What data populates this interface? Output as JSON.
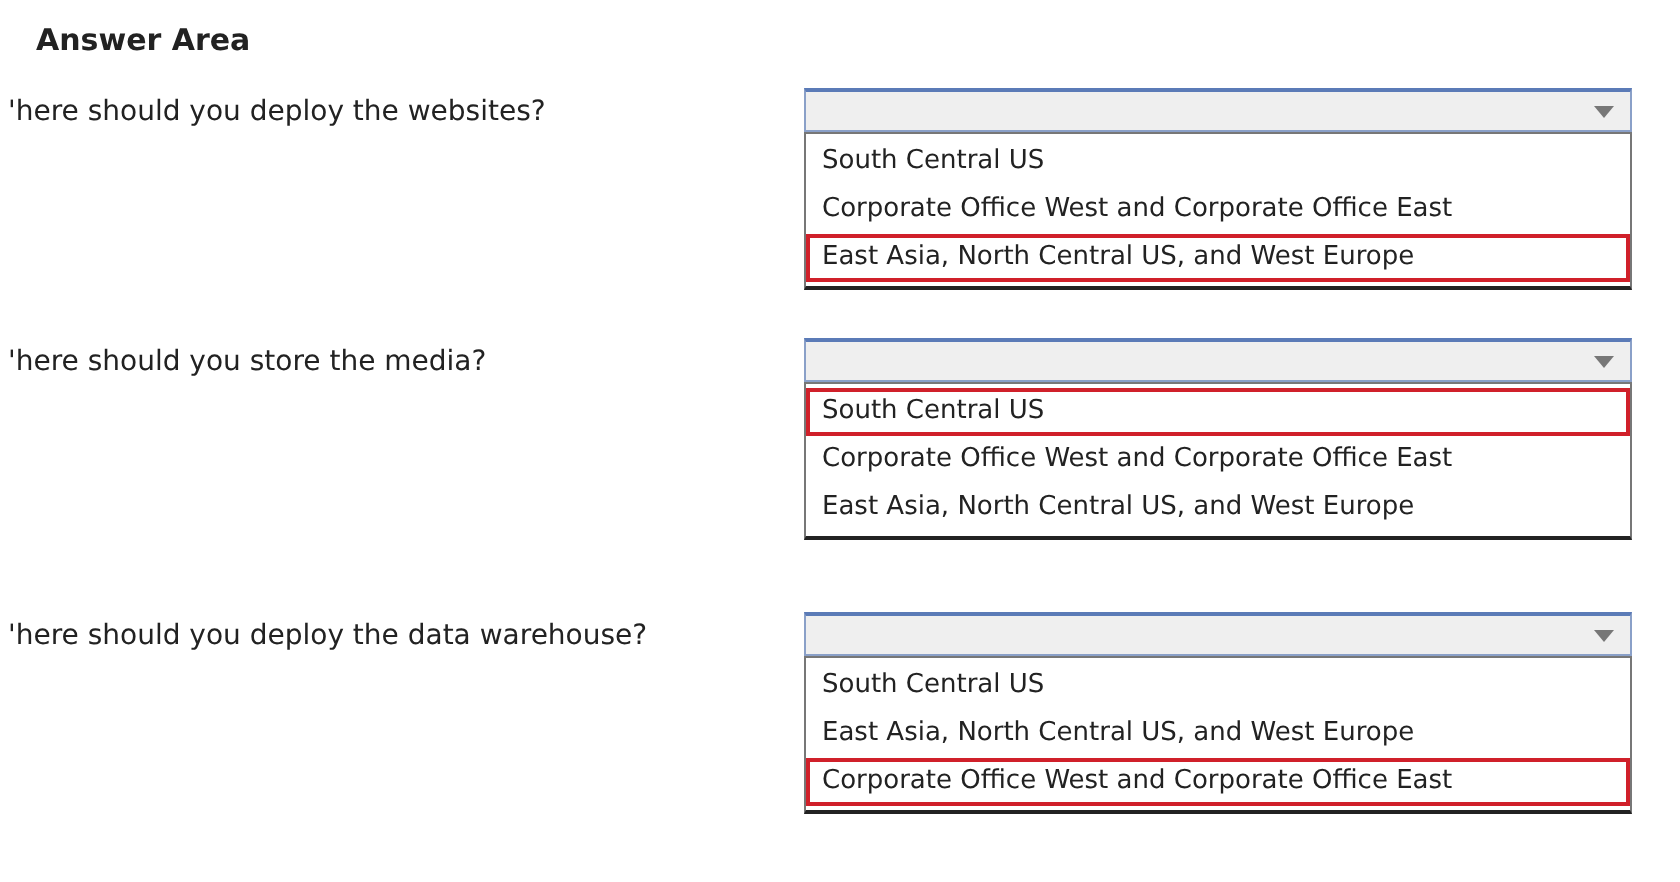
{
  "heading": "Answer Area",
  "questions": [
    {
      "text": "'here should you deploy the websites?",
      "options": [
        {
          "label": "South Central US",
          "selected": false
        },
        {
          "label": "Corporate Office West and Corporate Office East",
          "selected": false
        },
        {
          "label": "East Asia, North Central US, and West Europe",
          "selected": true
        }
      ]
    },
    {
      "text": "'here should you store the media?",
      "options": [
        {
          "label": "South Central US",
          "selected": true
        },
        {
          "label": "Corporate Office West and Corporate Office East",
          "selected": false
        },
        {
          "label": "East Asia, North Central US, and West Europe",
          "selected": false
        }
      ]
    },
    {
      "text": "'here should you deploy the data warehouse?",
      "options": [
        {
          "label": "South Central US",
          "selected": false
        },
        {
          "label": "East Asia, North Central US, and West Europe",
          "selected": false
        },
        {
          "label": "Corporate Office West and Corporate Office East",
          "selected": true
        }
      ]
    }
  ]
}
